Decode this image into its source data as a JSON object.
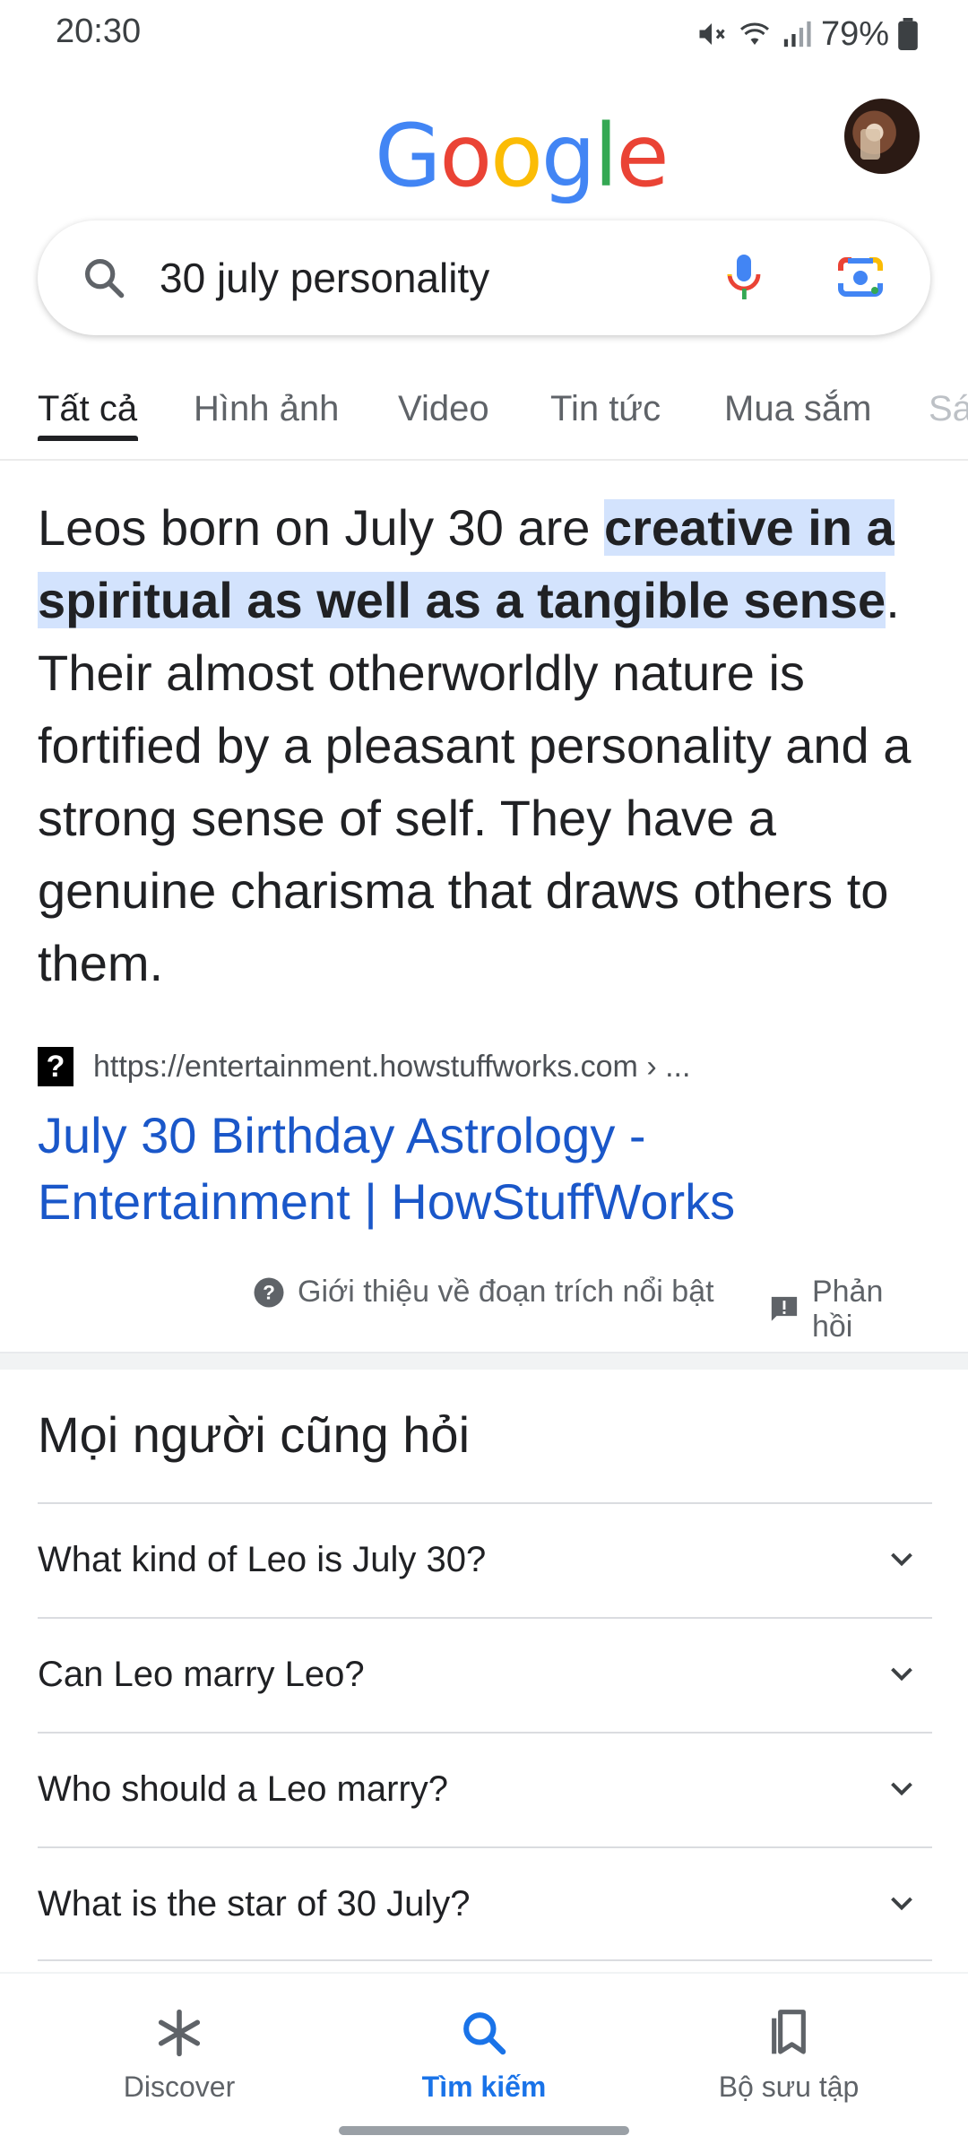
{
  "status_bar": {
    "time": "20:30",
    "battery": "79%"
  },
  "header": {
    "logo_letters": [
      {
        "char": "G",
        "color": "#4285F4"
      },
      {
        "char": "o",
        "color": "#EA4335"
      },
      {
        "char": "o",
        "color": "#FBBC05"
      },
      {
        "char": "g",
        "color": "#4285F4"
      },
      {
        "char": "l",
        "color": "#34A853"
      },
      {
        "char": "e",
        "color": "#EA4335"
      }
    ]
  },
  "search": {
    "query": "30 july personality"
  },
  "tabs": [
    {
      "label": "Tất cả",
      "active": true
    },
    {
      "label": "Hình ảnh",
      "active": false
    },
    {
      "label": "Video",
      "active": false
    },
    {
      "label": "Tin tức",
      "active": false
    },
    {
      "label": "Mua sắm",
      "active": false
    },
    {
      "label": "Sá",
      "active": false
    }
  ],
  "featured_snippet": {
    "text_before": "Leos born on July 30 are ",
    "highlight": "creative in a spiritual as well as a tangible sense",
    "text_after": ". Their almost otherworldly nature is fortified by a pleasant personality and a strong sense of self. They have a genuine charisma that draws others to them.",
    "source_url": "https://entertainment.howstuffworks.com › ...",
    "result_title": "July 30 Birthday Astrology - Entertainment | HowStuffWorks",
    "about_label": "Giới thiệu về đoạn trích nổi bật",
    "feedback_label": "Phản hồi"
  },
  "people_also_ask": {
    "title": "Mọi người cũng hỏi",
    "questions": [
      "What kind of Leo is July 30?",
      "Can Leo marry Leo?",
      "Who should a Leo marry?",
      "What is the star of 30 July?"
    ]
  },
  "bottom_nav": [
    {
      "label": "Discover",
      "icon": "asterisk-icon",
      "active": false
    },
    {
      "label": "Tìm kiếm",
      "icon": "search-icon",
      "active": true
    },
    {
      "label": "Bộ sưu tập",
      "icon": "collections-icon",
      "active": false
    }
  ],
  "colors": {
    "accent": "#1a73e8",
    "link": "#1a57c9",
    "highlight": "#d3e3fd"
  }
}
